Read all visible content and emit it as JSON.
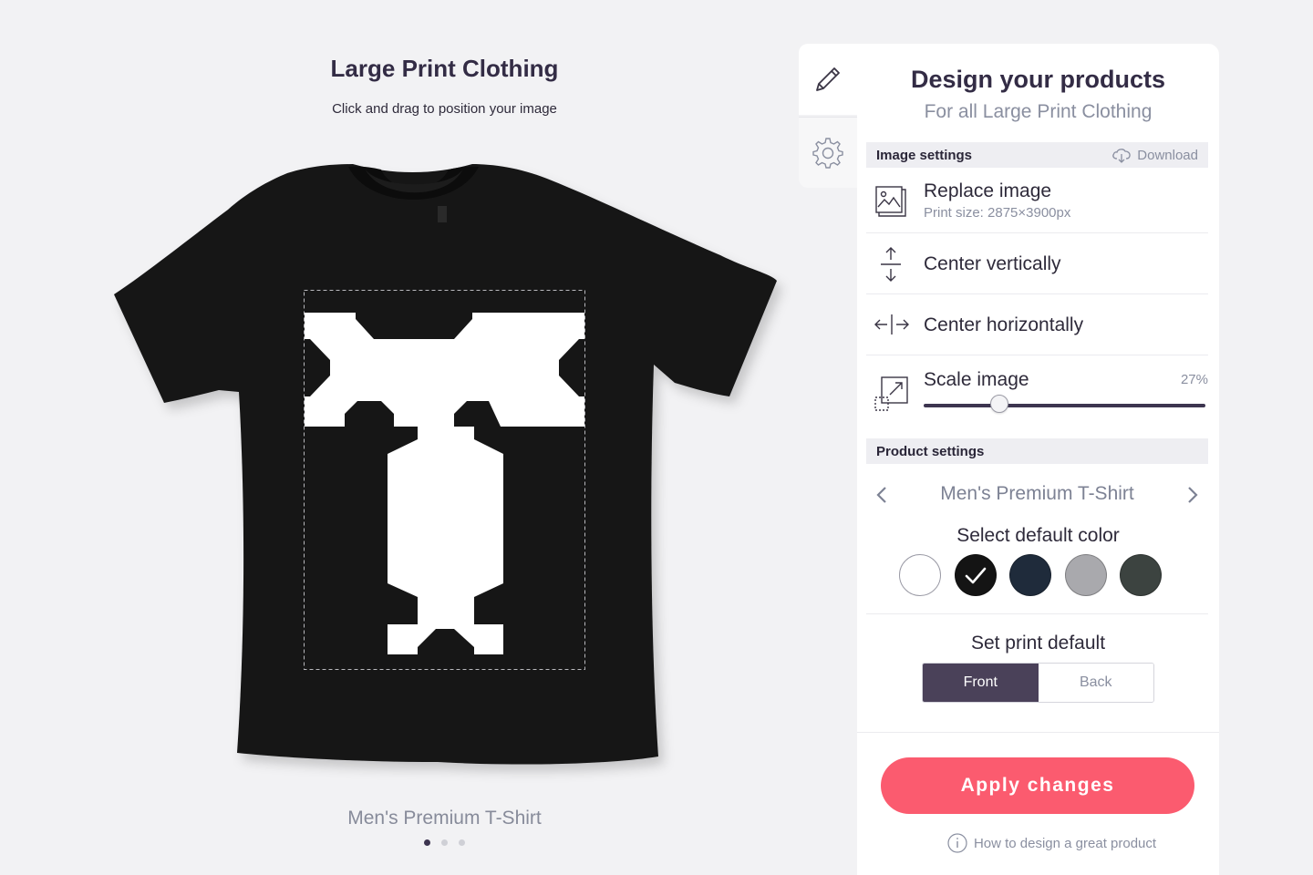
{
  "preview": {
    "title": "Large Print Clothing",
    "subtitle": "Click and drag to position your image",
    "product_name": "Men's Premium T-Shirt",
    "carousel": {
      "total": 3,
      "active": 1
    }
  },
  "side_tabs": [
    {
      "icon": "pencil-icon",
      "active": true
    },
    {
      "icon": "gear-icon",
      "active": false
    }
  ],
  "panel": {
    "title": "Design your products",
    "subtitle": "For all Large Print Clothing",
    "image_settings": {
      "label": "Image settings",
      "download_label": "Download",
      "replace_label": "Replace image",
      "print_size": "Print size: 2875×3900px",
      "center_vertically_label": "Center vertically",
      "center_horizontally_label": "Center horizontally",
      "scale_label": "Scale image",
      "scale_value": "27%",
      "scale_fraction": 0.27
    },
    "product_settings": {
      "label": "Product settings",
      "product_name": "Men's Premium T-Shirt",
      "select_color_label": "Select default color",
      "colors": [
        {
          "name": "white",
          "hex": "#ffffff",
          "selected": false
        },
        {
          "name": "black",
          "hex": "#141414",
          "selected": true
        },
        {
          "name": "navy",
          "hex": "#1f2b3b",
          "selected": false
        },
        {
          "name": "heather-grey",
          "hex": "#a9a9ad",
          "selected": false
        },
        {
          "name": "charcoal",
          "hex": "#3c4340",
          "selected": false
        }
      ],
      "print_default_label": "Set print default",
      "print_options": [
        "Front",
        "Back"
      ],
      "selected_print": "Front"
    },
    "apply_label": "Apply changes",
    "help_label": "How to design a great product"
  },
  "colors": {
    "accent": "#fb5b6f",
    "dark": "#4a4159",
    "muted_text": "#8a8fa0",
    "shirt": "#161616"
  }
}
